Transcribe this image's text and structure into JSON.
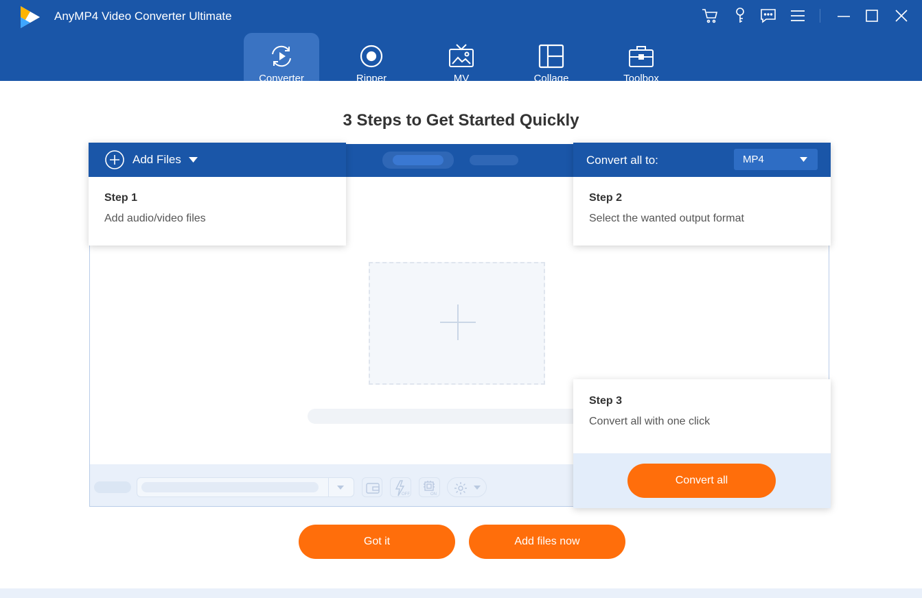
{
  "app": {
    "title": "AnyMP4 Video Converter Ultimate"
  },
  "toolbar": {
    "icons": [
      "cart-icon",
      "key-icon",
      "feedback-icon",
      "menu-icon",
      "minimize-icon",
      "maximize-icon",
      "close-icon"
    ]
  },
  "nav": {
    "active": "Converter",
    "tabs": [
      {
        "label": "Converter",
        "icon": "converter-icon"
      },
      {
        "label": "Ripper",
        "icon": "ripper-icon"
      },
      {
        "label": "MV",
        "icon": "mv-icon"
      },
      {
        "label": "Collage",
        "icon": "collage-icon"
      },
      {
        "label": "Toolbox",
        "icon": "toolbox-icon"
      }
    ]
  },
  "main": {
    "title": "3 Steps to Get Started Quickly"
  },
  "step1": {
    "button_label": "Add Files",
    "title": "Step 1",
    "desc": "Add audio/video files"
  },
  "step2": {
    "label": "Convert all to:",
    "format": "MP4",
    "title": "Step 2",
    "desc": "Select the wanted output format"
  },
  "step3": {
    "title": "Step 3",
    "desc": "Convert all with one click",
    "button": "Convert all"
  },
  "actions": {
    "got_it": "Got it",
    "add_now": "Add files now"
  },
  "colors": {
    "brand_blue": "#1a56a8",
    "accent_orange": "#ff6e0b",
    "light_blue": "#e9f0fa"
  }
}
